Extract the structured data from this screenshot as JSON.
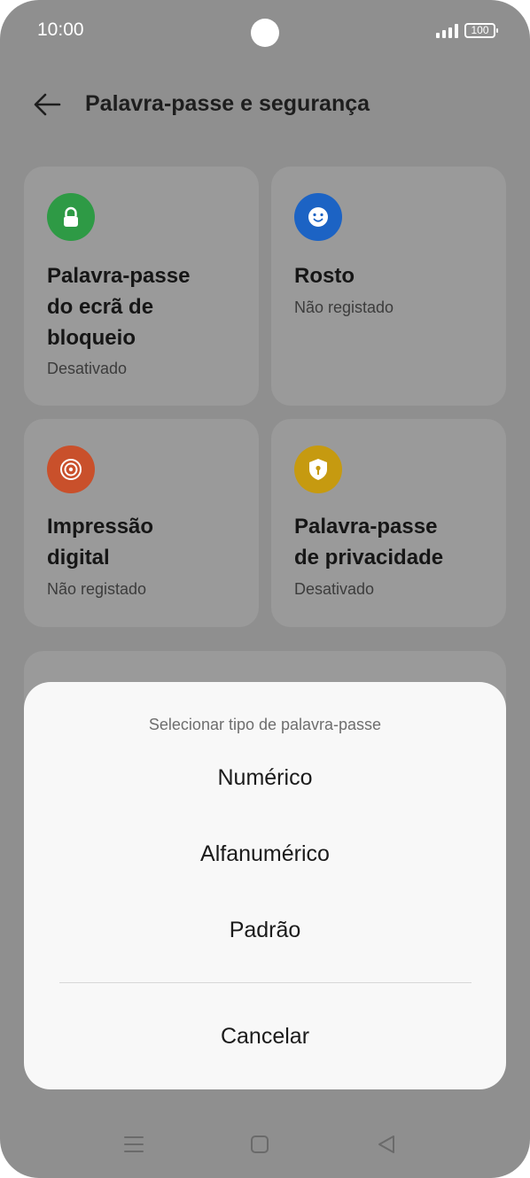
{
  "status_bar": {
    "time": "10:00",
    "battery": "100"
  },
  "header": {
    "title": "Palavra-passe e segurança"
  },
  "tiles": [
    {
      "title_lines": [
        "Palavra-passe",
        "do ecrã de",
        "bloqueio"
      ],
      "status": "Desativado",
      "icon": "lock-icon",
      "color": "#2e9a45"
    },
    {
      "title_lines": [
        "Rosto"
      ],
      "status": "Não registado",
      "icon": "face-icon",
      "color": "#1c63c4"
    },
    {
      "title_lines": [
        "Impressão",
        "digital"
      ],
      "status": "Não registado",
      "icon": "fingerprint-icon",
      "color": "#c9502b"
    },
    {
      "title_lines": [
        "Palavra-passe",
        "de privacidade"
      ],
      "status": "Desativado",
      "icon": "shield-key-icon",
      "color": "#c69a10"
    }
  ],
  "sheet": {
    "title": "Selecionar tipo de palavra-passe",
    "options": [
      "Numérico",
      "Alfanumérico",
      "Padrão"
    ],
    "cancel": "Cancelar"
  },
  "nav": {
    "icons": [
      "menu-icon",
      "home-icon",
      "back-triangle-icon"
    ]
  }
}
